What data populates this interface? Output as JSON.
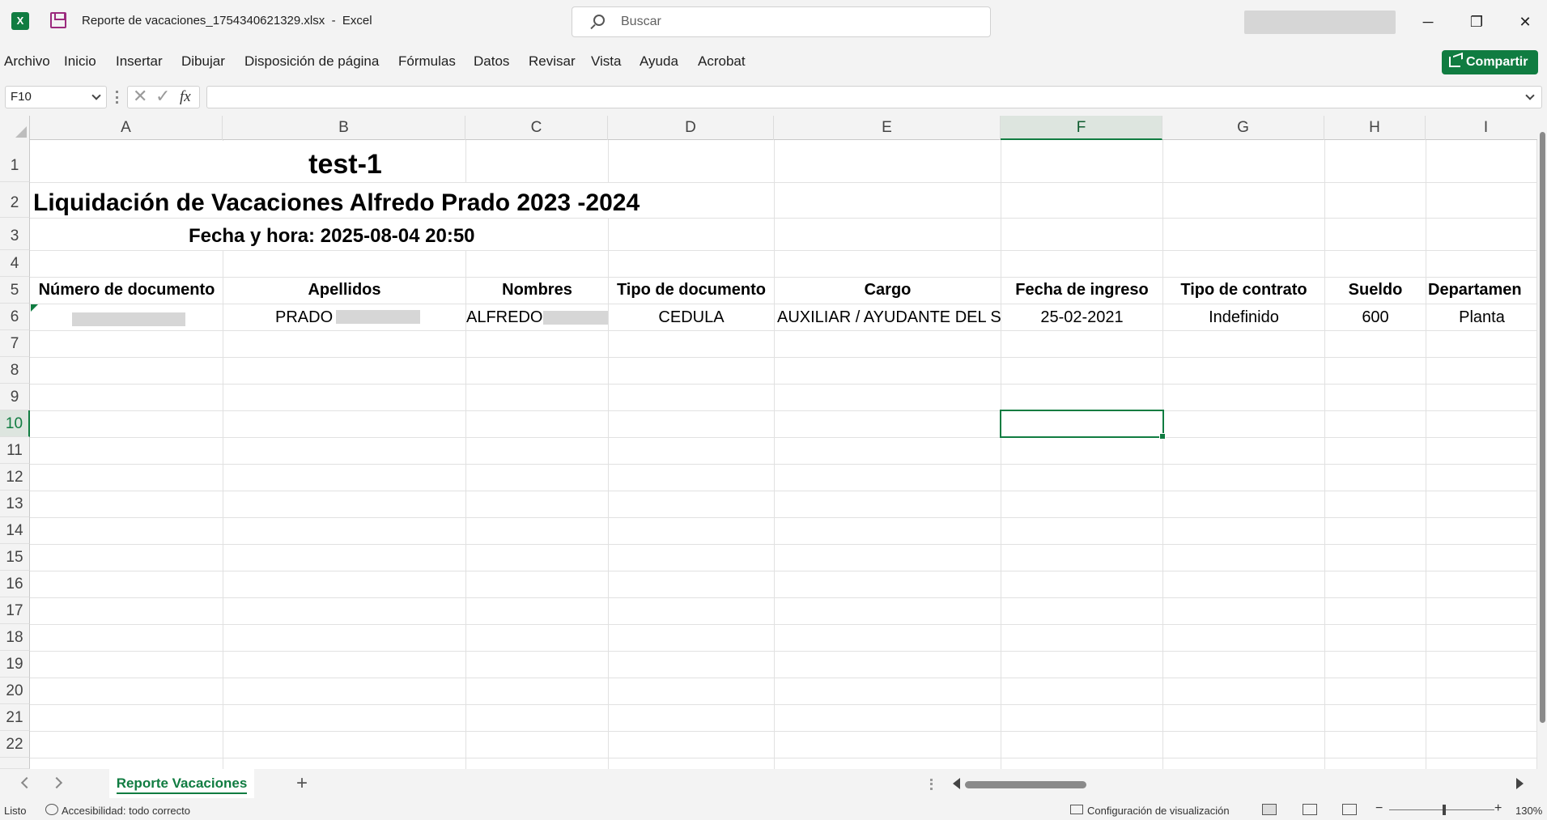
{
  "titlebar": {
    "filename": "Reporte de vacaciones_1754340621329.xlsx",
    "separator": "-",
    "app": "Excel",
    "search_placeholder": "Buscar",
    "logo_letter": "X",
    "minimize": "─",
    "restore": "❐",
    "close": "✕"
  },
  "menu": [
    "Archivo",
    "Inicio",
    "Insertar",
    "Dibujar",
    "Disposición de página",
    "Fórmulas",
    "Datos",
    "Revisar",
    "Vista",
    "Ayuda",
    "Acrobat"
  ],
  "share_label": "Compartir",
  "formula_bar": {
    "name_box": "F10",
    "fx": "fx",
    "cancel": "✕",
    "enter": "✓",
    "content": ""
  },
  "columns": [
    "A",
    "B",
    "C",
    "D",
    "E",
    "F",
    "G",
    "H",
    "I"
  ],
  "selected_column": "F",
  "rows": [
    "1",
    "2",
    "3",
    "4",
    "5",
    "6",
    "7",
    "8",
    "9",
    "10",
    "11",
    "12",
    "13",
    "14",
    "15",
    "16",
    "17",
    "18",
    "19",
    "20",
    "21",
    "22"
  ],
  "selected_row": "10",
  "sheet": {
    "title": "test-1",
    "subtitle": "Liquidación de Vacaciones Alfredo Prado 2023 -2024",
    "datetime": "Fecha y hora: 2025-08-04 20:50",
    "headers": [
      "Número de documento",
      "Apellidos",
      "Nombres",
      "Tipo de documento",
      "Cargo",
      "Fecha de ingreso",
      "Tipo de contrato",
      "Sueldo",
      "Departamen"
    ],
    "row6": {
      "apellidos": "PRADO",
      "nombres": "ALFREDO",
      "tipo_documento": "CEDULA",
      "cargo": "AUXILIAR / AYUDANTE DEL S",
      "fecha_ingreso": "25-02-2021",
      "tipo_contrato": "Indefinido",
      "sueldo": "600",
      "departamento": "Planta"
    }
  },
  "sheet_tabs": {
    "active": "Reporte Vacaciones",
    "add": "+"
  },
  "status": {
    "ready": "Listo",
    "accessibility": "Accesibilidad: todo correcto",
    "display_settings": "Configuración de visualización",
    "zoom_minus": "−",
    "zoom_plus": "+",
    "zoom": "130%"
  }
}
